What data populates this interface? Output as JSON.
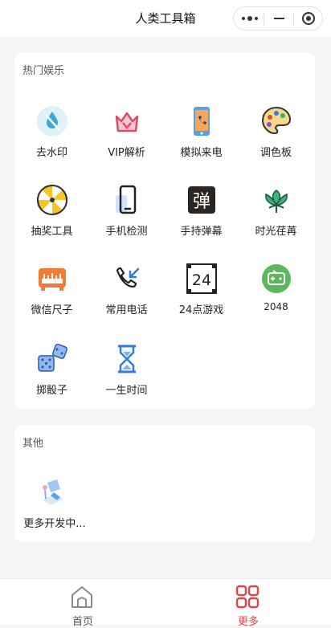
{
  "window": {
    "title": "人类工具箱"
  },
  "colors": {
    "accent": "#d94b4b",
    "muted": "#888888"
  },
  "sections": {
    "entertainment": {
      "title": "热门娱乐",
      "items": [
        {
          "label": "去水印",
          "icon": "watermark-drop-icon"
        },
        {
          "label": "VIP解析",
          "icon": "vip-crown-icon"
        },
        {
          "label": "模拟来电",
          "icon": "phone-call-icon"
        },
        {
          "label": "调色板",
          "icon": "palette-icon"
        },
        {
          "label": "抽奖工具",
          "icon": "lottery-wheel-icon"
        },
        {
          "label": "手机检测",
          "icon": "mobile-phone-icon"
        },
        {
          "label": "手持弹幕",
          "icon": "danmu-icon",
          "glyph": "弹"
        },
        {
          "label": "时光荏苒",
          "icon": "lotus-icon"
        },
        {
          "label": "微信尺子",
          "icon": "ruler-icon"
        },
        {
          "label": "常用电话",
          "icon": "phone-incoming-icon"
        },
        {
          "label": "24点游戏",
          "icon": "game-24-icon",
          "glyph": "24"
        },
        {
          "label": "2048",
          "icon": "gamepad-icon"
        },
        {
          "label": "掷骰子",
          "icon": "dice-icon"
        },
        {
          "label": "一生时间",
          "icon": "hourglass-icon"
        }
      ]
    },
    "other": {
      "title": "其他",
      "items": [
        {
          "label": "更多开发中...",
          "icon": "in-development-icon"
        }
      ]
    }
  },
  "tabbar": {
    "home": {
      "label": "首页",
      "icon": "home-icon"
    },
    "more": {
      "label": "更多",
      "icon": "grid-icon"
    }
  }
}
